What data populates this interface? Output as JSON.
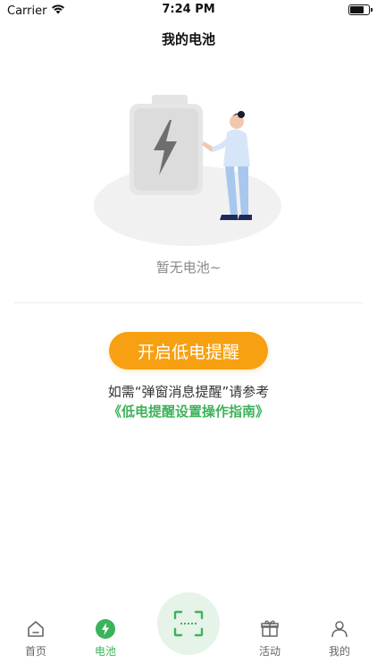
{
  "status": {
    "carrier": "Carrier",
    "time": "7:24 PM"
  },
  "header": {
    "title": "我的电池"
  },
  "empty_state": {
    "text": "暂无电池~"
  },
  "cta": {
    "label": "开启低电提醒"
  },
  "hint": {
    "text": "如需“弹窗消息提醒”请参考",
    "link": "《低电提醒设置操作指南》"
  },
  "tabbar": {
    "items": [
      {
        "label": "首页",
        "icon": "home-icon"
      },
      {
        "label": "电池",
        "icon": "battery-bolt-icon",
        "active": true
      },
      {
        "label": "",
        "icon": "scan-icon"
      },
      {
        "label": "活动",
        "icon": "gift-icon"
      },
      {
        "label": "我的",
        "icon": "user-icon"
      }
    ]
  },
  "colors": {
    "accent_green": "#3cb35a",
    "cta_orange": "#f7a012"
  }
}
